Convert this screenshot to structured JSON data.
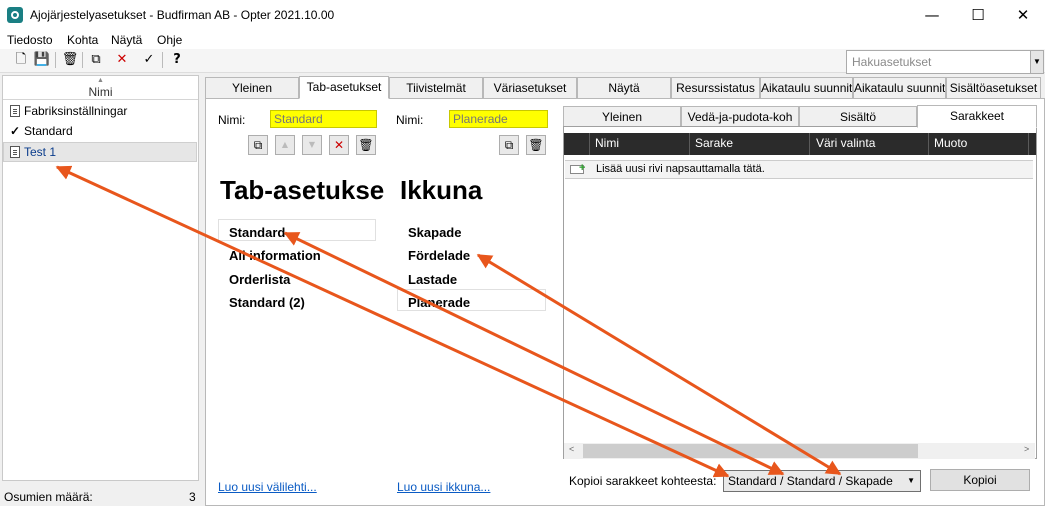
{
  "window": {
    "title": "Ajojärjestelyasetukset - Budfirman AB - Opter 2021.10.00",
    "controls": {
      "minimize": "—",
      "maximize": "☐",
      "close": "✕"
    }
  },
  "menu": [
    "Tiedosto",
    "Kohta",
    "Näytä",
    "Ohje"
  ],
  "toolbar": {
    "icons": [
      "new-icon",
      "save-icon",
      "delete-icon",
      "copy-icon",
      "cancel-icon",
      "check-icon",
      "help-icon"
    ],
    "glyphs": {
      "new": "🗋",
      "save": "💾",
      "delete": "🗑",
      "copy": "⧉",
      "cancel": "✕",
      "check": "✓",
      "help": "?"
    },
    "search_placeholder": "Hakuasetukset",
    "search_dropdown": "▼"
  },
  "left_panel": {
    "column_header": "Nimi",
    "sort_indicator": "▲",
    "items": [
      {
        "label": "Fabriksinställningar",
        "icon": "doc-icon"
      },
      {
        "label": "Standard",
        "icon": "check-icon",
        "glyph": "✓"
      },
      {
        "label": "Test 1",
        "icon": "doc-icon",
        "selected": true,
        "color": "#0a3c8c"
      }
    ],
    "status_label": "Osumien määrä:",
    "status_count": "3"
  },
  "main_tabs": [
    "Yleinen",
    "Tab-asetukset",
    "Tiivistelmät",
    "Väriasetukset",
    "Näytä",
    "Resurssistatus",
    "Aikataulu suunnitt",
    "Aikataulu suunnitt",
    "Sisältöasetukset"
  ],
  "active_main_tab": "Tab-asetukset",
  "tab_settings": {
    "name_label_left": "Nimi:",
    "name_value_left": "Standard",
    "name_label_right": "Nimi:",
    "name_value_right": "Planerade",
    "button_glyphs": {
      "copy": "⧉",
      "up": "▲",
      "down": "▼",
      "remove": "✕",
      "trash": "🗑"
    },
    "heading_tabs": "Tab-asetukse",
    "heading_windows": "Ikkuna",
    "tabs_list": [
      "Standard",
      "All information",
      "Orderlista",
      "Standard (2)"
    ],
    "windows_list": [
      "Skapade",
      "Fördelade",
      "Lastade",
      "Planerade"
    ],
    "new_tab_link": "Luo uusi välilehti...",
    "new_window_link": "Luo uusi ikkuna..."
  },
  "sub_tabs": [
    "Yleinen",
    "Vedä-ja-pudota-koh",
    "Sisältö",
    "Sarakkeet"
  ],
  "active_sub_tab": "Sarakkeet",
  "columns_grid": {
    "headers": [
      "Nimi",
      "Sarake",
      "Väri valinta",
      "Muoto"
    ],
    "new_row_text": "Lisää uusi rivi napsauttamalla tätä.",
    "scroll_left": "<",
    "scroll_right": ">"
  },
  "copy_columns": {
    "label": "Kopioi sarakkeet kohteesta:",
    "selected_value": "Standard / Standard / Skapade",
    "dropdown_arrow": "▼",
    "button_label": "Kopioi"
  },
  "annotation_color": "#e8561c"
}
